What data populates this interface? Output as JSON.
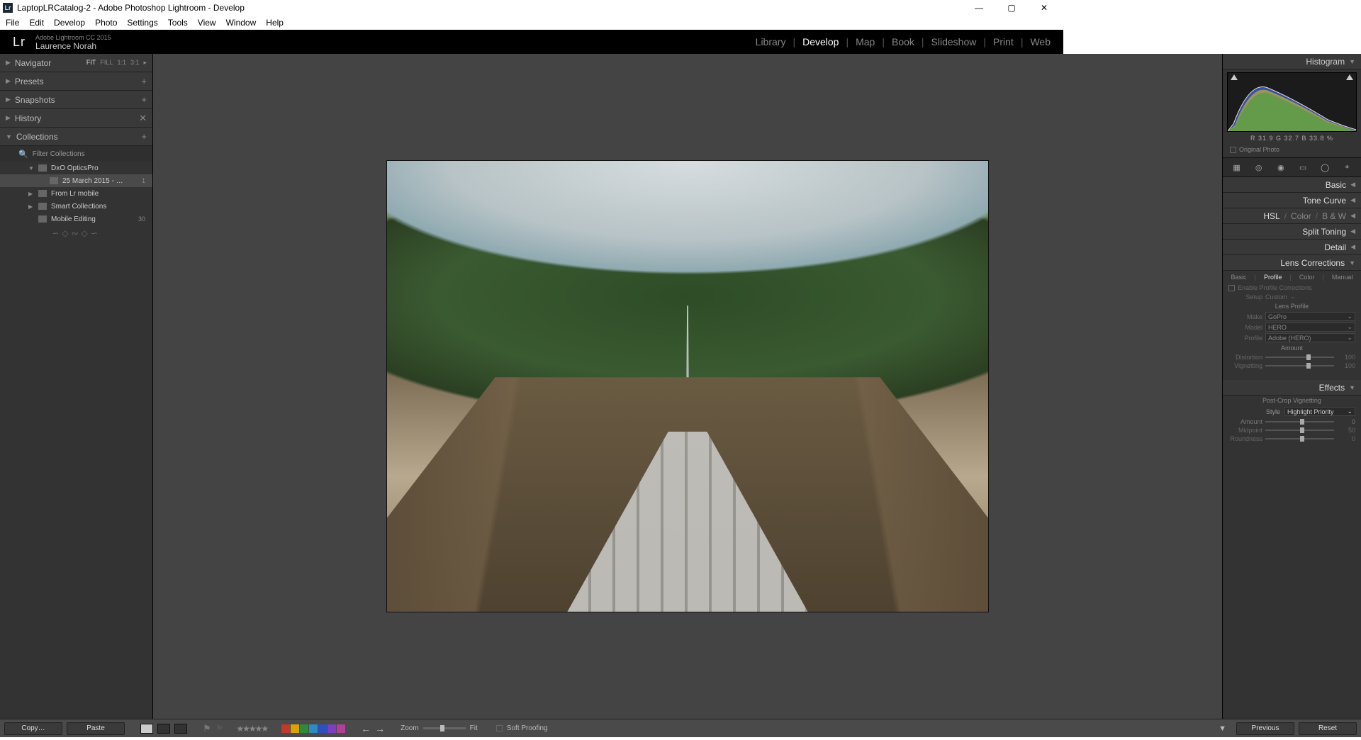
{
  "window": {
    "title": "LaptopLRCatalog-2 - Adobe Photoshop Lightroom - Develop",
    "app_icon_label": "Lr"
  },
  "menus": [
    "File",
    "Edit",
    "Develop",
    "Photo",
    "Settings",
    "Tools",
    "View",
    "Window",
    "Help"
  ],
  "branding": {
    "logo": "Lr",
    "product": "Adobe Lightroom CC 2015",
    "user": "Laurence Norah"
  },
  "modules": {
    "items": [
      "Library",
      "Develop",
      "Map",
      "Book",
      "Slideshow",
      "Print",
      "Web"
    ],
    "active": "Develop"
  },
  "left": {
    "navigator": {
      "label": "Navigator",
      "zoom": [
        "FIT",
        "FILL",
        "1:1",
        "3:1"
      ],
      "zoom_sel": "FIT"
    },
    "presets": {
      "label": "Presets"
    },
    "snapshots": {
      "label": "Snapshots"
    },
    "history": {
      "label": "History"
    },
    "collections": {
      "label": "Collections",
      "filter": "Filter Collections",
      "items": [
        {
          "label": "DxO OpticsPro",
          "depth": 1,
          "expandable": true,
          "open": true
        },
        {
          "label": "25 March 2015 - …",
          "depth": 2,
          "count": "1",
          "selected": true
        },
        {
          "label": "From Lr mobile",
          "depth": 1,
          "expandable": true
        },
        {
          "label": "Smart Collections",
          "depth": 1,
          "expandable": true
        },
        {
          "label": "Mobile Editing",
          "depth": 1,
          "count": "30"
        }
      ]
    }
  },
  "right": {
    "histogram": {
      "label": "Histogram",
      "rgb": "R  31.9   G  32.7   B  33.8  %",
      "original": "Original Photo"
    },
    "sections": {
      "basic": "Basic",
      "tone": "Tone Curve",
      "hsl": "HSL",
      "color": "Color",
      "bw": "B & W",
      "split": "Split Toning",
      "detail": "Detail",
      "lens": "Lens Corrections",
      "effects": "Effects"
    },
    "lens": {
      "tabs": [
        "Basic",
        "Profile",
        "Color",
        "Manual"
      ],
      "tab_active": "Profile",
      "enable": "Enable Profile Corrections",
      "setup_label": "Setup",
      "setup_value": "Custom",
      "profile_header": "Lens Profile",
      "make_label": "Make",
      "make_value": "GoPro",
      "model_label": "Model",
      "model_value": "HERO",
      "profile_label": "Profile",
      "profile_value": "Adobe (HERO)",
      "amount_header": "Amount",
      "distortion_label": "Distortion",
      "distortion_value": "100",
      "vignetting_label": "Vignetting",
      "vignetting_value": "100"
    },
    "effects": {
      "pcv": "Post-Crop Vignetting",
      "style_label": "Style",
      "style_value": "Highlight Priority",
      "amount_label": "Amount",
      "amount_value": "0",
      "midpoint_label": "Midpoint",
      "midpoint_value": "50",
      "roundness_label": "Roundness",
      "roundness_value": "0"
    }
  },
  "bottom": {
    "copy": "Copy…",
    "paste": "Paste",
    "zoom_label": "Zoom",
    "zoom_value": "Fit",
    "soft_proof": "Soft Proofing",
    "previous": "Previous",
    "reset": "Reset",
    "swatches": [
      "#c0392b",
      "#d9a400",
      "#2e8b3c",
      "#2e8bc0",
      "#2e4fc0",
      "#7c3fc0",
      "#b03f98",
      "#888"
    ]
  }
}
